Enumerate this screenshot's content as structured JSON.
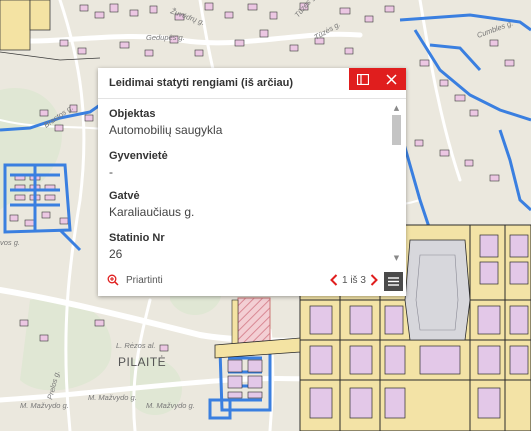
{
  "map": {
    "labels": {
      "gedupes": "Gedupės g.",
      "zuvedra": "Žuvėdrų g.",
      "tuzes": "Tūzės g.",
      "cumbles": "Cumbles g.",
      "brastos": "Brastos g.",
      "vos": "vos g.",
      "rezos": "L. Rėzos al.",
      "pilaite": "PILAITĖ",
      "prelos": "Prelos g.",
      "mazvydo1": "M. Mažvydo g.",
      "mazvydo2": "M. Mažvydo g.",
      "mazvydo3": "M. Mažvydo g."
    }
  },
  "popup": {
    "title": "Leidimai statyti rengiami (iš arčiau)",
    "fields": [
      {
        "label": "Objektas",
        "value": "Automobilių saugykla"
      },
      {
        "label": "Gyvenvietė",
        "value": "-"
      },
      {
        "label": "Gatvė",
        "value": "Karaliaučiaus g."
      },
      {
        "label": "Statinio Nr",
        "value": "26"
      }
    ],
    "zoom_label": "Priartinti",
    "pager": "1 iš 3",
    "colors": {
      "accent": "#e01e1e",
      "menu_bg": "#4a4a4a"
    }
  }
}
